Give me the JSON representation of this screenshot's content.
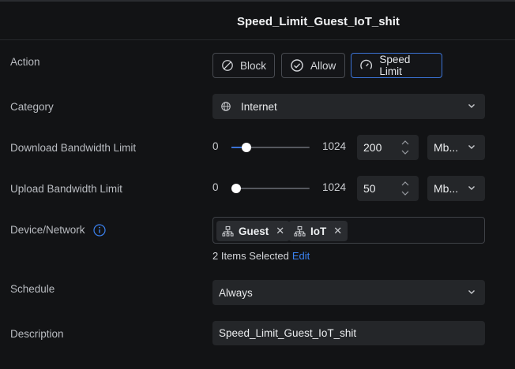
{
  "header": {
    "title": "Speed_Limit_Guest_IoT_shit"
  },
  "labels": {
    "action": "Action",
    "category": "Category",
    "download": "Download Bandwidth Limit",
    "upload": "Upload Bandwidth Limit",
    "device": "Device/Network",
    "schedule": "Schedule",
    "description": "Description"
  },
  "actions": {
    "block": "Block",
    "allow": "Allow",
    "speed_limit": "Speed Limit",
    "selected": "Speed Limit"
  },
  "category": {
    "value": "Internet",
    "icon": "globe-icon"
  },
  "download": {
    "min": "0",
    "max": "1024",
    "value": "200",
    "unit": "Mb...",
    "fraction": 0.195
  },
  "upload": {
    "min": "0",
    "max": "1024",
    "value": "50",
    "unit": "Mb...",
    "fraction": 0.049
  },
  "devices": {
    "items": [
      {
        "label": "Guest",
        "icon": "network-icon"
      },
      {
        "label": "IoT",
        "icon": "network-icon"
      }
    ],
    "count_text": "2 Items Selected",
    "edit_label": "Edit"
  },
  "schedule": {
    "value": "Always"
  },
  "description": {
    "value": "Speed_Limit_Guest_IoT_shit"
  },
  "colors": {
    "accent": "#3b73d6",
    "link": "#3b82f0",
    "background": "#121315",
    "field": "#242629"
  }
}
